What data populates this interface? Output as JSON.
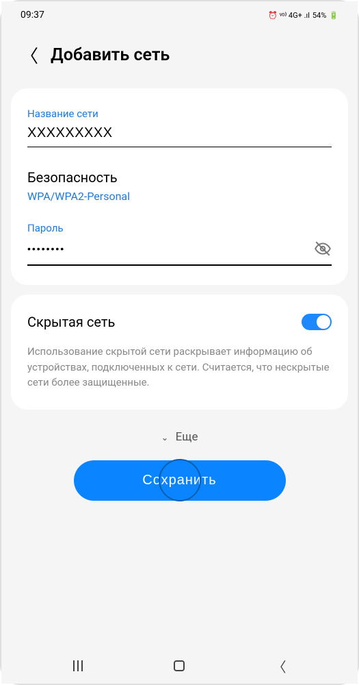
{
  "status": {
    "time": "09:37",
    "indicators": "⏰ ᵛᵒ⁾ 4G+ .ıl",
    "lte": "LTE1",
    "battery": "54%"
  },
  "header": {
    "title": "Добавить сеть"
  },
  "network_name": {
    "label": "Название сети",
    "value": "XXXXXXXXX"
  },
  "security": {
    "label": "Безопасность",
    "value": "WPA/WPA2-Personal"
  },
  "password": {
    "label": "Пароль",
    "value": "••••••••"
  },
  "hidden_network": {
    "label": "Скрытая сеть",
    "enabled": true,
    "warning": "Использование скрытой сети раскрывает информацию об устройствах, подключенных к сети. Считается, что нескрытые сети более защищенные."
  },
  "more_label": "Еще",
  "save_label": "Сохранить"
}
